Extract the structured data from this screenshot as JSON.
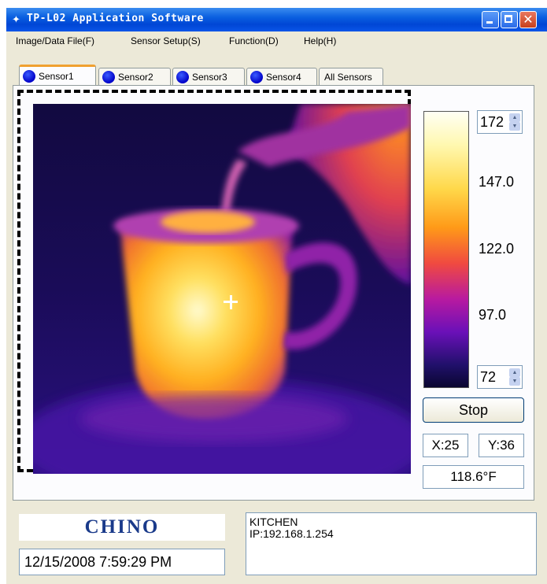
{
  "window": {
    "title": "TP-L02 Application Software",
    "icon": "app-icon"
  },
  "menu": [
    {
      "label": "Image/Data File(F)"
    },
    {
      "label": "Sensor Setup(S)"
    },
    {
      "label": "Function(D)"
    },
    {
      "label": "Help(H)"
    }
  ],
  "tabs": [
    {
      "label": "Sensor1",
      "active": true
    },
    {
      "label": "Sensor2"
    },
    {
      "label": "Sensor3"
    },
    {
      "label": "Sensor4"
    },
    {
      "label": "All Sensors"
    }
  ],
  "scale": {
    "max_value": "172",
    "min_value": "72",
    "labels": [
      "147.0",
      "122.0",
      "97.0"
    ]
  },
  "controls": {
    "stop_label": "Stop"
  },
  "cursor": {
    "x": "X:25",
    "y": "Y:36"
  },
  "temperature": "118.6°F",
  "footer": {
    "logo": "CHINO",
    "datetime": "12/15/2008 7:59:29 PM",
    "location": "KITCHEN",
    "ip": "IP:192.168.1.254"
  },
  "colors": {
    "title_bar": "#0046d5",
    "tab_dot": "#0000c8",
    "active_tab_accent": "#f0a030",
    "logo": "#1a3a8a"
  }
}
